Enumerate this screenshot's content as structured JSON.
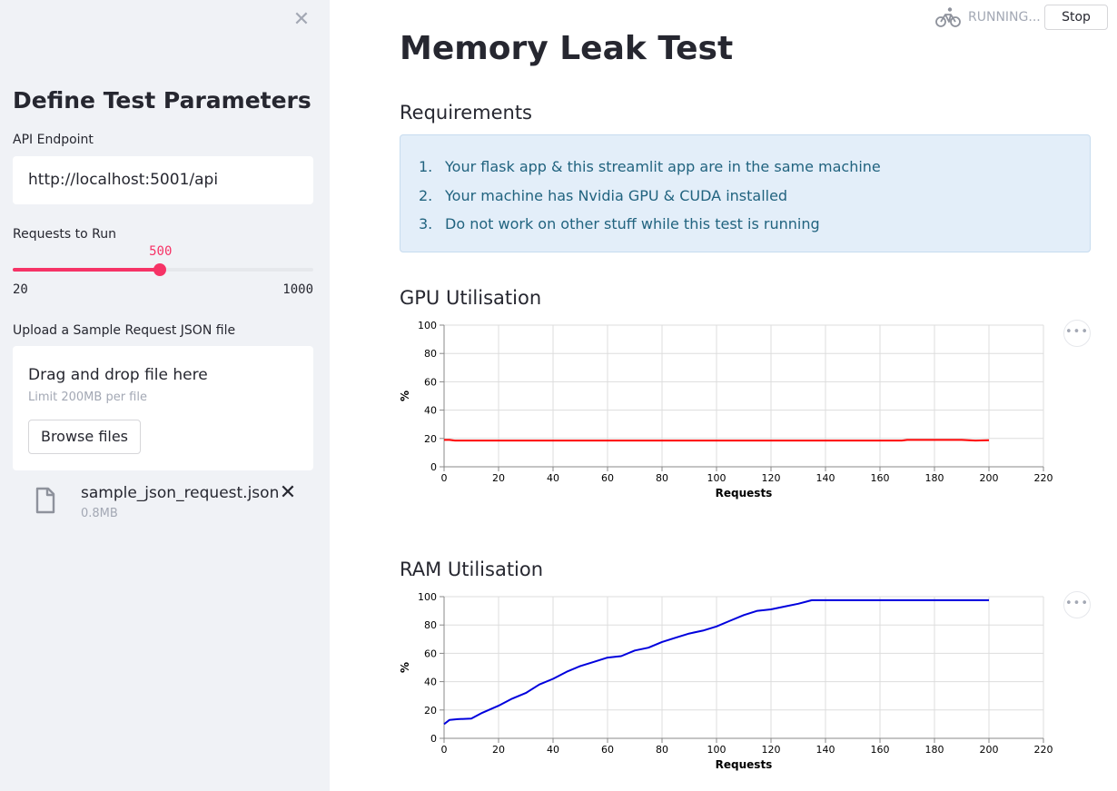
{
  "sidebar": {
    "close_icon": "close-icon",
    "title": "Define Test Parameters",
    "endpoint_label": "API Endpoint",
    "endpoint_value": "http://localhost:5001/api",
    "requests_label": "Requests to Run",
    "slider": {
      "value": "500",
      "min": "20",
      "max": "1000",
      "value_num": 500,
      "min_num": 20,
      "max_num": 1000
    },
    "upload_label": "Upload a Sample Request JSON file",
    "dropzone_title": "Drag and drop file here",
    "dropzone_limit": "Limit 200MB per file",
    "browse_label": "Browse files",
    "file": {
      "name": "sample_json_request.json",
      "size": "0.8MB",
      "icon": "file-icon"
    }
  },
  "status": {
    "icon": "bicycle-icon",
    "text": "RUNNING...",
    "stop_label": "Stop"
  },
  "main": {
    "title": "Memory Leak Test",
    "requirements_header": "Requirements",
    "requirements": [
      {
        "num": "1.",
        "text": "Your flask app & this streamlit app are in the same machine"
      },
      {
        "num": "2.",
        "text": "Your machine has Nvidia GPU & CUDA installed"
      },
      {
        "num": "3.",
        "text": "Do not work on other stuff while this test is running"
      }
    ],
    "gpu_header": "GPU Utilisation",
    "ram_header": "RAM Utilisation",
    "more_icon": "more-horizontal-icon"
  },
  "colors": {
    "accent": "#f63366",
    "gpu_line": "#ff0000",
    "ram_line": "#0000dd",
    "info_text": "#21637f",
    "info_bg": "#e3eef9"
  },
  "chart_data": [
    {
      "type": "line",
      "xlabel": "Requests",
      "ylabel": "%",
      "xlim": [
        0,
        220
      ],
      "ylim": [
        0,
        100
      ],
      "xticks": [
        0,
        20,
        40,
        60,
        80,
        100,
        120,
        140,
        160,
        180,
        200,
        220
      ],
      "yticks": [
        0,
        20,
        40,
        60,
        80,
        100
      ],
      "grid": true,
      "series": [
        {
          "color": "#ff0000",
          "x": [
            0,
            2,
            4,
            10,
            20,
            40,
            60,
            80,
            100,
            120,
            140,
            160,
            168,
            170,
            175,
            180,
            185,
            190,
            195,
            200
          ],
          "y": [
            19,
            19,
            18.5,
            18.5,
            18.5,
            18.5,
            18.5,
            18.5,
            18.5,
            18.5,
            18.5,
            18.5,
            18.5,
            19,
            19,
            19,
            19,
            19,
            18.5,
            18.8
          ]
        }
      ]
    },
    {
      "type": "line",
      "xlabel": "Requests",
      "ylabel": "%",
      "xlim": [
        0,
        220
      ],
      "ylim": [
        0,
        100
      ],
      "xticks": [
        0,
        20,
        40,
        60,
        80,
        100,
        120,
        140,
        160,
        180,
        200,
        220
      ],
      "yticks": [
        0,
        20,
        40,
        60,
        80,
        100
      ],
      "grid": true,
      "series": [
        {
          "color": "#0000dd",
          "x": [
            0,
            2,
            5,
            10,
            14,
            20,
            25,
            30,
            35,
            40,
            45,
            50,
            55,
            60,
            65,
            70,
            75,
            80,
            85,
            90,
            95,
            100,
            105,
            110,
            115,
            120,
            125,
            130,
            135,
            140,
            150,
            160,
            170,
            180,
            190,
            200
          ],
          "y": [
            10,
            13,
            13.5,
            14,
            18,
            23,
            28,
            32,
            38,
            42,
            47,
            51,
            54,
            57,
            58,
            62,
            64,
            68,
            71,
            74,
            76,
            79,
            83,
            87,
            90,
            91,
            93,
            95,
            97.5,
            97.5,
            97.5,
            97.5,
            97.5,
            97.5,
            97.5,
            97.5
          ]
        }
      ]
    }
  ]
}
